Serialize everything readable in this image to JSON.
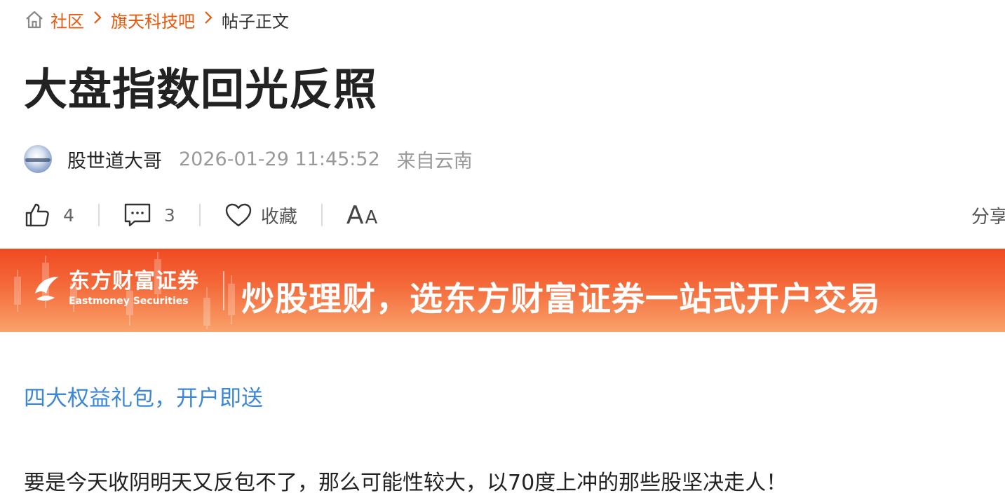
{
  "breadcrumb": {
    "items": [
      {
        "label": "社区"
      },
      {
        "label": "旗天科技吧"
      },
      {
        "label": "帖子正文"
      }
    ],
    "home_icon": "home-icon",
    "link_color": "#e8590c"
  },
  "post": {
    "title": "大盘指数回光反照",
    "author": "股世道大哥",
    "time": "2026-01-29 11:45:52",
    "location": "来自云南",
    "body": "要是今天收阴明天又反包不了，那么可能性较大，以70度上冲的那些股坚决走人！"
  },
  "actions": {
    "like_count": "4",
    "comment_count": "3",
    "favorite_label": "收藏",
    "font_size_big": "A",
    "font_size_small": "A",
    "share_label": "分享到"
  },
  "banner": {
    "logo_cn": "东方财富证券",
    "logo_en": "Eastmoney Securities",
    "slogan": "炒股理财，选东方财富证券一站式开户交易",
    "gradient_top": "#f04a22",
    "gradient_bottom": "#f9a26b"
  },
  "promo": {
    "link_text": "四大权益礼包，开户即送",
    "link_color": "#3b86d6"
  }
}
